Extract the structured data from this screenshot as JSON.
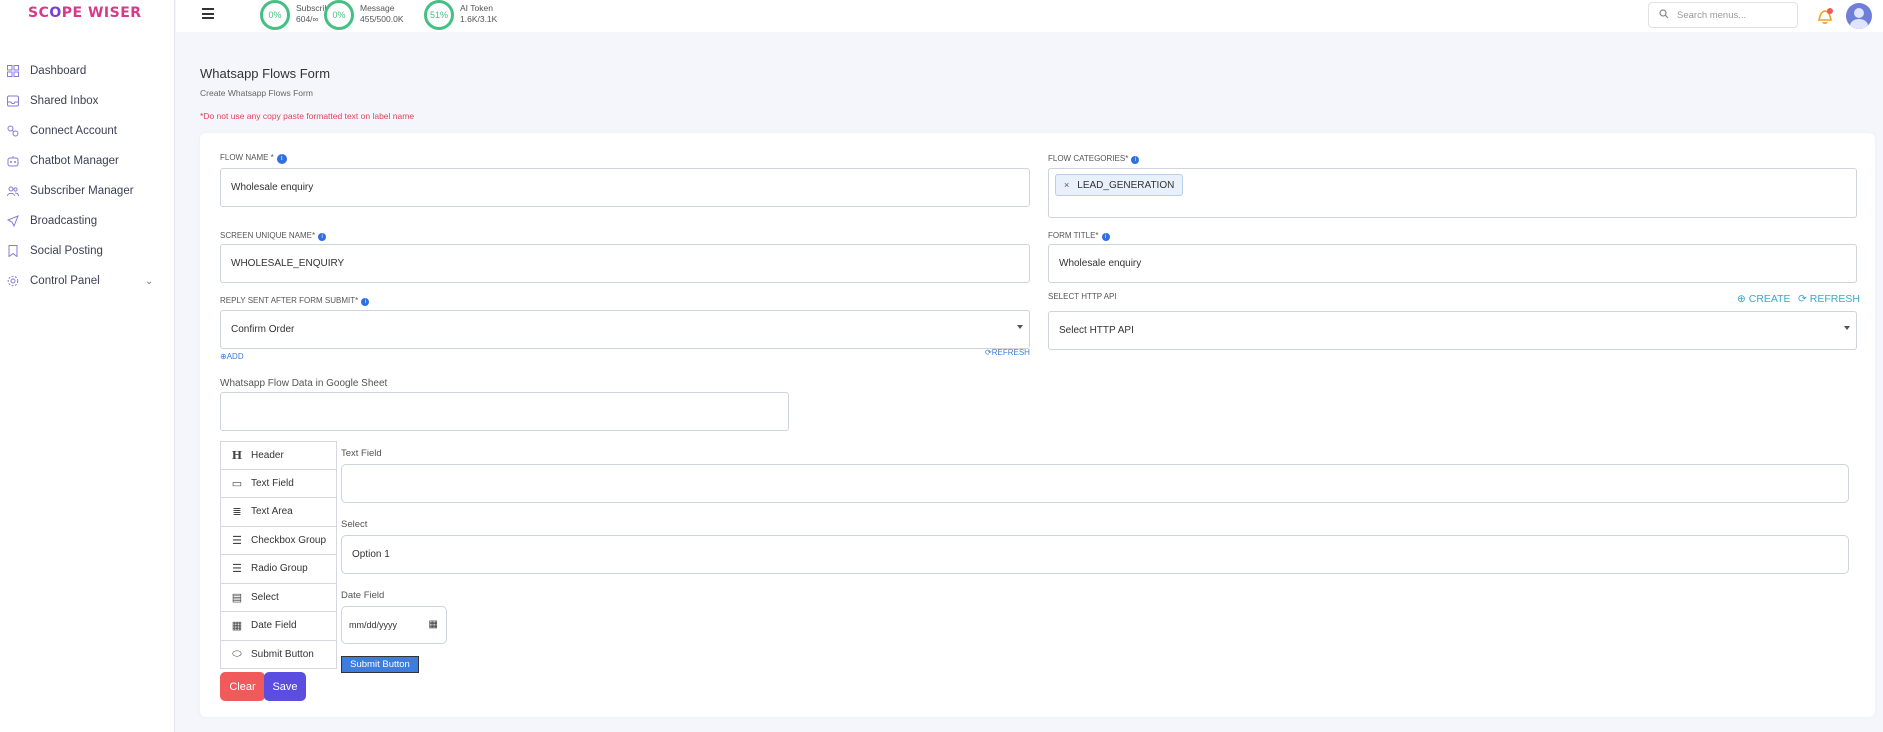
{
  "brand": {
    "name_a": "SC",
    "name_o": "O",
    "name_b": "PE WISER"
  },
  "sidebar": {
    "items": [
      {
        "label": "Dashboard"
      },
      {
        "label": "Shared Inbox"
      },
      {
        "label": "Connect Account"
      },
      {
        "label": "Chatbot Manager"
      },
      {
        "label": "Subscriber Manager"
      },
      {
        "label": "Broadcasting"
      },
      {
        "label": "Social Posting"
      },
      {
        "label": "Control Panel"
      }
    ]
  },
  "topbar": {
    "stats": [
      {
        "percent": "0%",
        "label": "Subscriber",
        "value": "604/∞"
      },
      {
        "percent": "0%",
        "label": "Message",
        "value": "455/500.0K"
      },
      {
        "percent": "51%",
        "label": "AI Token",
        "value": "1.6K/3.1K"
      }
    ],
    "search_placeholder": "Search menus..."
  },
  "page": {
    "title": "Whatsapp Flows Form",
    "subtitle": "Create Whatsapp Flows Form",
    "warning": "*Do not use any copy paste formatted text on label name"
  },
  "form": {
    "flow_name_label": "FLOW NAME *",
    "flow_name_value": "Wholesale enquiry",
    "flow_categories_label": "FLOW CATEGORIES*",
    "flow_category_tag": "LEAD_GENERATION",
    "screen_name_label": "SCREEN UNIQUE NAME*",
    "screen_name_value": "WHOLESALE_ENQUIRY",
    "form_title_label": "FORM TITLE*",
    "form_title_value": "Wholesale enquiry",
    "reply_label": "REPLY SENT AFTER FORM SUBMIT*",
    "reply_value": "Confirm Order",
    "add_link": "ADD",
    "refresh_small": "REFRESH",
    "http_api_label": "SELECT HTTP API",
    "http_api_value": "Select HTTP API",
    "create_link": "CREATE",
    "refresh_link": "REFRESH",
    "google_sheet_label": "Whatsapp Flow Data in Google Sheet",
    "google_sheet_value": ""
  },
  "palette": {
    "items": [
      {
        "label": "Header",
        "icon": "H"
      },
      {
        "label": "Text Field",
        "icon": "▭"
      },
      {
        "label": "Text Area",
        "icon": "≣"
      },
      {
        "label": "Checkbox Group",
        "icon": "☰"
      },
      {
        "label": "Radio Group",
        "icon": "☰"
      },
      {
        "label": "Select",
        "icon": "▤"
      },
      {
        "label": "Date Field",
        "icon": "▦"
      },
      {
        "label": "Submit Button",
        "icon": "⬭"
      }
    ]
  },
  "preview": {
    "text_field_label": "Text Field",
    "text_field_value": "",
    "select_label": "Select",
    "select_value": "Option 1",
    "date_label": "Date Field",
    "date_placeholder": "mm/dd/yyyy",
    "submit_label": "Submit Button"
  },
  "actions": {
    "clear": "Clear",
    "save": "Save"
  },
  "colors": {
    "accent": "#5b4de0",
    "danger": "#f05a5a",
    "ring": "#44c083",
    "link": "#3aa9c7"
  }
}
